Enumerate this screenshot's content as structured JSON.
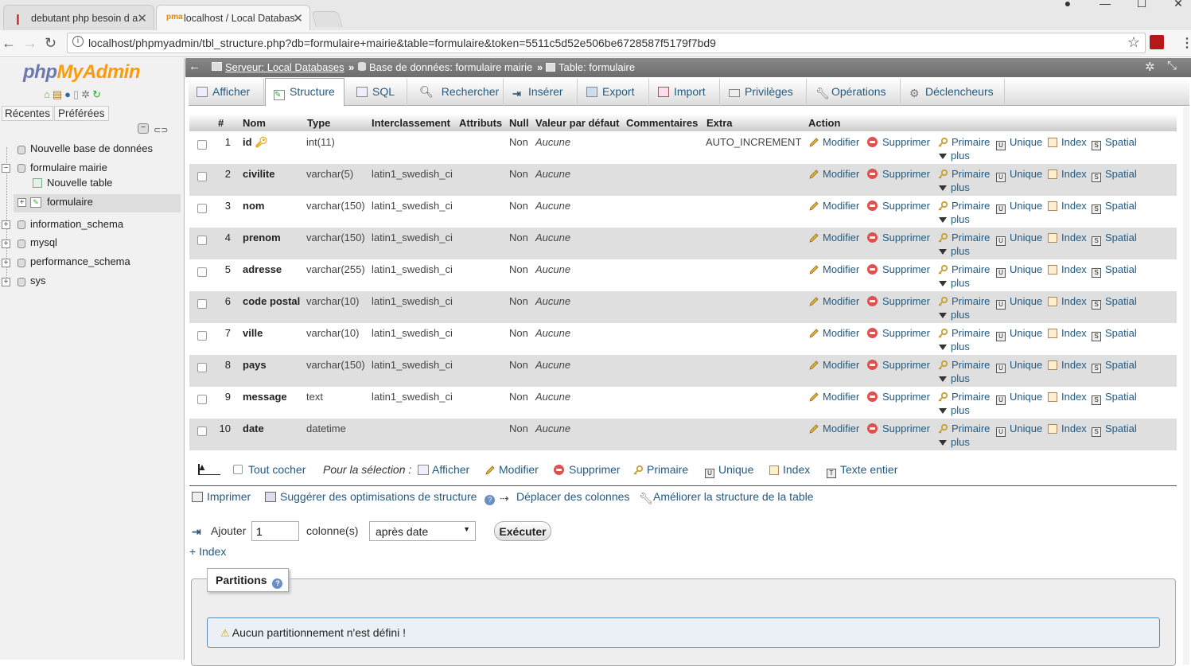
{
  "browser": {
    "tabs": [
      {
        "title": "debutant php besoin d a"
      },
      {
        "title": "localhost / Local Databas"
      }
    ],
    "url": "localhost/phpmyadmin/tbl_structure.php?db=formulaire+mairie&table=formulaire&token=5511c5d52e506be6728587f5179f7bd9"
  },
  "sidebar": {
    "logo_php": "php",
    "logo_myadmin": "MyAdmin",
    "recent": "Récentes",
    "favorites": "Préférées",
    "tree": {
      "new_db": "Nouvelle base de données",
      "db_formulaire": "formulaire mairie",
      "new_table": "Nouvelle table",
      "table_formulaire": "formulaire",
      "db_info": "information_schema",
      "db_mysql": "mysql",
      "db_perf": "performance_schema",
      "db_sys": "sys"
    }
  },
  "breadcrumb": {
    "server": "Serveur: Local Databases",
    "sep": "»",
    "database": "Base de données: formulaire mairie",
    "table": "Table: formulaire"
  },
  "menu": {
    "browse": "Afficher",
    "structure": "Structure",
    "sql": "SQL",
    "search": "Rechercher",
    "insert": "Insérer",
    "export": "Export",
    "import": "Import",
    "privileges": "Privilèges",
    "operations": "Opérations",
    "triggers": "Déclencheurs"
  },
  "table": {
    "headers": {
      "num": "#",
      "name": "Nom",
      "type": "Type",
      "collation": "Interclassement",
      "attributes": "Attributs",
      "null": "Null",
      "default": "Valeur par défaut",
      "comments": "Commentaires",
      "extra": "Extra",
      "action": "Action"
    },
    "rows": [
      {
        "num": "1",
        "name": "id",
        "type": "int(11)",
        "collation": "",
        "null": "Non",
        "default": "Aucune",
        "extra": "AUTO_INCREMENT"
      },
      {
        "num": "2",
        "name": "civilite",
        "type": "varchar(5)",
        "collation": "latin1_swedish_ci",
        "null": "Non",
        "default": "Aucune",
        "extra": ""
      },
      {
        "num": "3",
        "name": "nom",
        "type": "varchar(150)",
        "collation": "latin1_swedish_ci",
        "null": "Non",
        "default": "Aucune",
        "extra": ""
      },
      {
        "num": "4",
        "name": "prenom",
        "type": "varchar(150)",
        "collation": "latin1_swedish_ci",
        "null": "Non",
        "default": "Aucune",
        "extra": ""
      },
      {
        "num": "5",
        "name": "adresse",
        "type": "varchar(255)",
        "collation": "latin1_swedish_ci",
        "null": "Non",
        "default": "Aucune",
        "extra": ""
      },
      {
        "num": "6",
        "name": "code postal",
        "type": "varchar(10)",
        "collation": "latin1_swedish_ci",
        "null": "Non",
        "default": "Aucune",
        "extra": ""
      },
      {
        "num": "7",
        "name": "ville",
        "type": "varchar(10)",
        "collation": "latin1_swedish_ci",
        "null": "Non",
        "default": "Aucune",
        "extra": ""
      },
      {
        "num": "8",
        "name": "pays",
        "type": "varchar(150)",
        "collation": "latin1_swedish_ci",
        "null": "Non",
        "default": "Aucune",
        "extra": ""
      },
      {
        "num": "9",
        "name": "message",
        "type": "text",
        "collation": "latin1_swedish_ci",
        "null": "Non",
        "default": "Aucune",
        "extra": ""
      },
      {
        "num": "10",
        "name": "date",
        "type": "datetime",
        "collation": "",
        "null": "Non",
        "default": "Aucune",
        "extra": ""
      }
    ],
    "actions": {
      "modify": "Modifier",
      "delete": "Supprimer",
      "primary": "Primaire",
      "unique": "Unique",
      "index": "Index",
      "spatial": "Spatial",
      "more": "plus"
    }
  },
  "selection": {
    "check_all": "Tout cocher",
    "for_selection": "Pour la sélection :",
    "browse": "Afficher",
    "modify": "Modifier",
    "delete": "Supprimer",
    "primary": "Primaire",
    "unique": "Unique",
    "index": "Index",
    "fulltext": "Texte entier"
  },
  "tools": {
    "print": "Imprimer",
    "suggest": "Suggérer des optimisations de structure",
    "move_columns": "Déplacer des colonnes",
    "improve": "Améliorer la structure de la table"
  },
  "add_columns": {
    "label": "Ajouter",
    "value": "1",
    "unit": "colonne(s)",
    "position": "après date",
    "execute": "Exécuter"
  },
  "add_index": "+ Index",
  "partitions": {
    "legend": "Partitions",
    "message": "Aucun partitionnement n'est défini !"
  }
}
